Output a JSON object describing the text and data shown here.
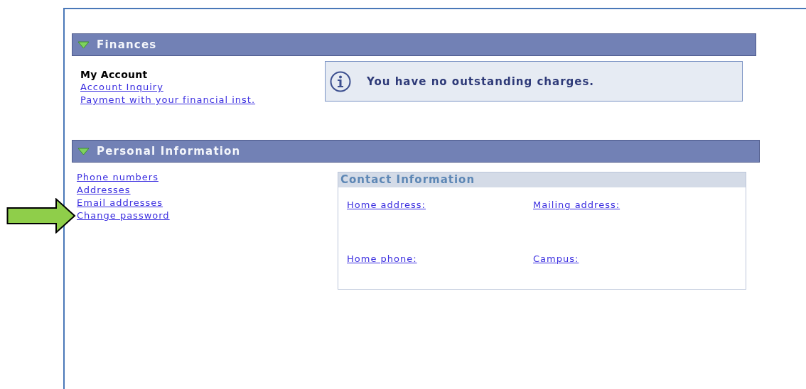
{
  "sections": [
    {
      "kind": "finances",
      "title": "Finances",
      "expanded": true,
      "group_title": "My Account",
      "links": [
        "Account Inquiry",
        "Payment with your financial inst."
      ],
      "message": "You have no outstanding charges."
    },
    {
      "kind": "personal",
      "title": "Personal Information",
      "expanded": true,
      "links": [
        "Phone numbers",
        "Addresses",
        "Email addresses",
        "Change password"
      ],
      "contact": {
        "title": "Contact Information",
        "fields": [
          "Home address:",
          "Mailing address:",
          "Home phone:",
          "Campus:"
        ]
      }
    }
  ]
}
